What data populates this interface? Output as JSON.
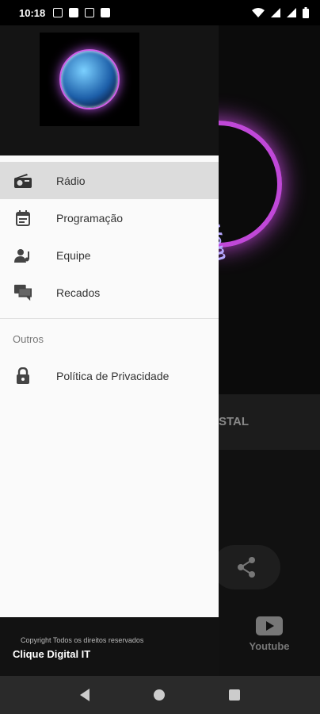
{
  "status_bar": {
    "time": "10:18",
    "icons": [
      "sim-icon",
      "facebook-icon",
      "tiktok-icon",
      "app-notification-icon",
      "wifi-icon",
      "signal-icon",
      "signal-icon",
      "battery-icon"
    ]
  },
  "drawer": {
    "logo_alt": "station-logo",
    "menu": [
      {
        "label": "Rádio",
        "icon": "radio-icon",
        "active": true
      },
      {
        "label": "Programação",
        "icon": "calendar-icon",
        "active": false
      },
      {
        "label": "Equipe",
        "icon": "team-icon",
        "active": false
      },
      {
        "label": "Recados",
        "icon": "chat-icon",
        "active": false
      }
    ],
    "section_label": "Outros",
    "other_items": [
      {
        "label": "Política de Privacidade",
        "icon": "lock-icon"
      }
    ],
    "footer": {
      "copyright": "Copyright Todos os direitos reservados",
      "brand": "Clique Digital IT"
    }
  },
  "background": {
    "hero_text": "Novo Vem",
    "band_text": "STAL",
    "youtube_label": "Youtube"
  }
}
